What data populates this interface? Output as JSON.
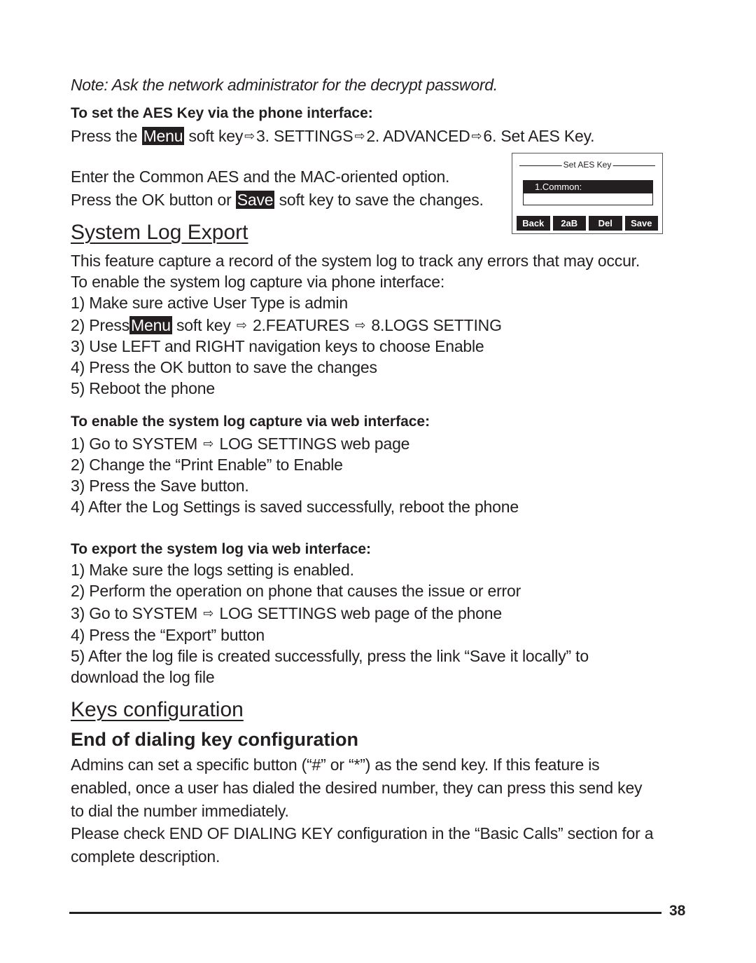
{
  "note": "Note: Ask the network administrator for the decrypt password.",
  "aes": {
    "heading": "To set the AES Key via the phone interface:",
    "line1": {
      "pre": "Press the",
      "key": "Menu",
      "post": "soft key",
      "steps": [
        "3. SETTINGS",
        "2. ADVANCED",
        "6. Set AES Key."
      ]
    },
    "line2": "Enter the Common AES and the MAC-oriented option.",
    "line3": {
      "pre": "Press the OK button or",
      "key": "Save",
      "post": "soft key to save the changes."
    }
  },
  "phone_screen": {
    "title": "Set AES Key",
    "field_label": "1.Common:",
    "field_value": "",
    "softkeys": [
      "Back",
      "2aB",
      "Del",
      "Save"
    ]
  },
  "system_log": {
    "title": "System Log Export",
    "intro": [
      "This feature capture a record of the system log to track any errors that may occur.",
      "To enable the system log capture via phone interface:"
    ],
    "phone_steps": {
      "s1": "1) Make sure active User Type is admin",
      "s2": {
        "pre": "2) Press",
        "key": "Menu",
        "post": "soft key",
        "a": "2.FEATURES",
        "b": "8.LOGS SETTING"
      },
      "s3": "3) Use LEFT and RIGHT navigation keys to choose Enable",
      "s4": "4) Press the OK button to save the changes",
      "s5": "5) Reboot the phone"
    },
    "web_heading": "To enable the system log capture via web interface:",
    "web_steps": {
      "s1": {
        "pre": "1) Go to SYSTEM",
        "post": "LOG SETTINGS web page"
      },
      "s2": "2) Change the “Print Enable” to Enable",
      "s3": "3) Press the Save button.",
      "s4": "4) After the Log Settings is saved successfully, reboot the phone"
    },
    "export_heading": "To export the system log via web interface:",
    "export_steps": {
      "s1": "1) Make sure the logs setting is enabled.",
      "s2": "2) Perform the operation on phone that causes the issue or error",
      "s3": {
        "pre": "3) Go to SYSTEM",
        "post": "LOG SETTINGS web page of the phone"
      },
      "s4": "4) Press the “Export” button",
      "s5a": "5) After the log file is created successfully, press the link “Save it locally” to",
      "s5b": "download the log file"
    }
  },
  "keys": {
    "title": "Keys configuration",
    "subtitle": "End of dialing key configuration",
    "para": [
      "Admins can set a specific button (“#” or “*”) as the send key. If this feature is",
      "enabled, once a user has dialed the desired number, they can press this send key",
      "to dial the number immediately.",
      "Please check END OF DIALING KEY configuration in the “Basic Calls” section for a",
      "complete description."
    ]
  },
  "arrow_glyph": "⇨",
  "page_number": "38"
}
